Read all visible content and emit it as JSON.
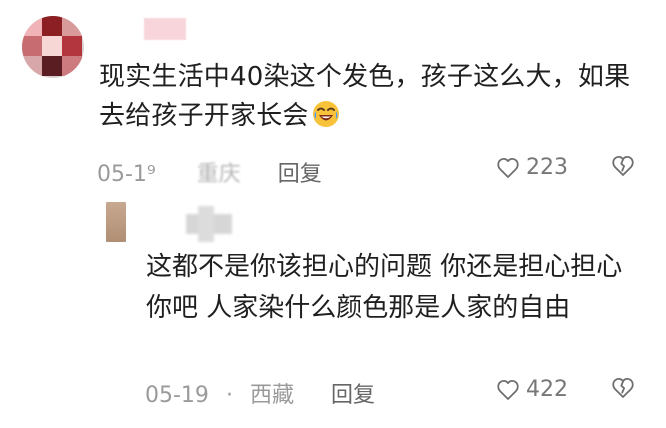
{
  "comment": {
    "text": "现实生活中40染这个发色，孩子这么大，如果去给孩子开家长会",
    "date": "05-1⁹",
    "location": "重庆",
    "reply_label": "回复",
    "likes": "223"
  },
  "reply": {
    "text": "这都不是你该担心的问题 你还是担心担心你吧 人家染什么颜色那是人家的自由",
    "date": "05-19",
    "separator": "·",
    "location": "西藏",
    "reply_label": "回复",
    "likes": "422"
  },
  "icons": {
    "emoji": "laughing-tears-emoji",
    "like": "heart-outline-icon",
    "dislike": "broken-heart-icon"
  },
  "colors": {
    "text": "#1f1f1f",
    "meta": "#9a9a9a",
    "emoji_face": "#f8c33a",
    "emoji_tears": "#4a9cff"
  }
}
